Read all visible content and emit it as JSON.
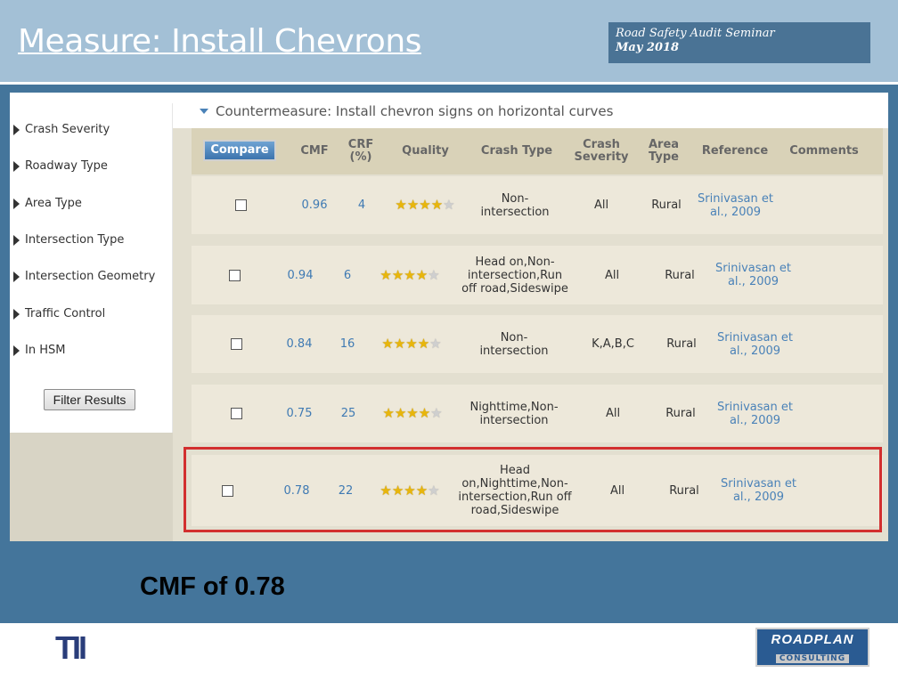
{
  "slide": {
    "title": "Measure: Install Chevrons",
    "seminar_line1": "Road Safety Audit Seminar",
    "seminar_line2": "May 2018",
    "note": "CMF of 0.78"
  },
  "sidebar": {
    "items": [
      {
        "label": "Crash Severity"
      },
      {
        "label": "Roadway Type"
      },
      {
        "label": "Area Type"
      },
      {
        "label": "Intersection Type"
      },
      {
        "label": "Intersection Geometry"
      },
      {
        "label": "Traffic Control"
      },
      {
        "label": "In HSM"
      }
    ],
    "filter_button": "Filter Results"
  },
  "countermeasure": {
    "title": "Countermeasure: Install chevron signs on horizontal curves"
  },
  "table": {
    "compare_label": "Compare",
    "headers": {
      "cmf": "CMF",
      "crf": "CRF (%)",
      "quality": "Quality",
      "crash_type": "Crash Type",
      "crash_severity": "Crash Severity",
      "area_type": "Area Type",
      "reference": "Reference",
      "comments": "Comments"
    },
    "rows": [
      {
        "cmf": "0.96",
        "crf": "4",
        "stars": 4,
        "crash_type": "Non-intersection",
        "severity": "All",
        "area": "Rural",
        "reference": "Srinivasan et al., 2009"
      },
      {
        "cmf": "0.94",
        "crf": "6",
        "stars": 4,
        "crash_type": "Head on,Non-intersection,Run off road,Sideswipe",
        "severity": "All",
        "area": "Rural",
        "reference": "Srinivasan et al., 2009"
      },
      {
        "cmf": "0.84",
        "crf": "16",
        "stars": 4,
        "crash_type": "Non-intersection",
        "severity": "K,A,B,C",
        "area": "Rural",
        "reference": "Srinivasan et al., 2009"
      },
      {
        "cmf": "0.75",
        "crf": "25",
        "stars": 4,
        "crash_type": "Nighttime,Non-intersection",
        "severity": "All",
        "area": "Rural",
        "reference": "Srinivasan et al., 2009"
      },
      {
        "cmf": "0.78",
        "crf": "22",
        "stars": 4,
        "crash_type": "Head on,Nighttime,Non-intersection,Run off road,Sideswipe",
        "severity": "All",
        "area": "Rural",
        "reference": "Srinivasan et al., 2009"
      }
    ]
  },
  "logos": {
    "left": "TII",
    "right_line1": "ROADPLAN",
    "right_line2": "CONSULTING"
  },
  "colors": {
    "header_bg": "#a3c0d6",
    "slide_bg": "#44759b",
    "highlight": "#d22f2f",
    "link": "#4a82b8"
  }
}
